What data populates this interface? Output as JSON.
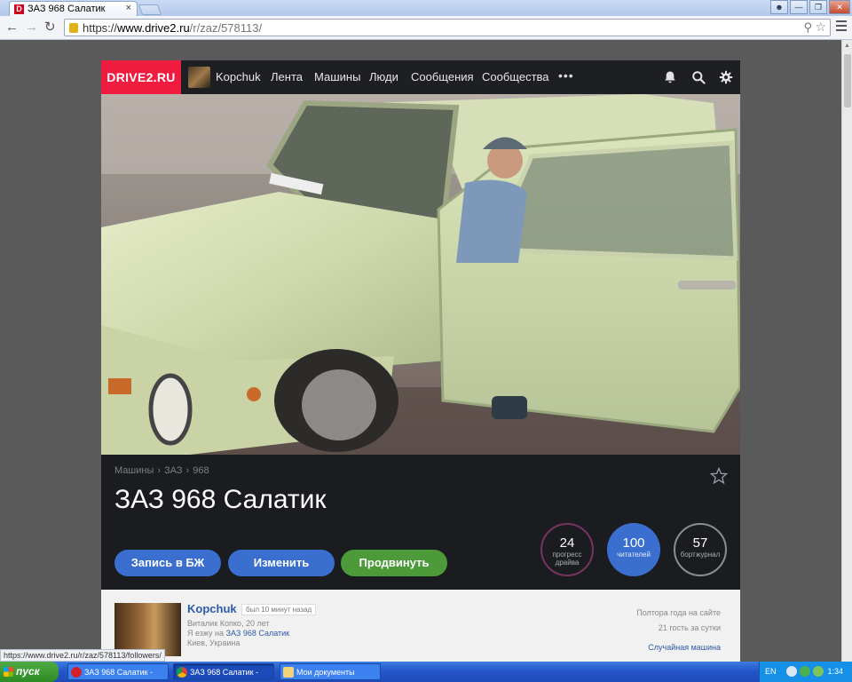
{
  "browser": {
    "tab_title": "ЗАЗ 968 Салатик",
    "tab_favicon": "D",
    "tab_close": "×",
    "url_scheme": "https://",
    "url_host": "www.drive2.ru",
    "url_path": "/r/zaz/578113/",
    "status_url": "https://www.drive2.ru/r/zaz/578113/followers/"
  },
  "site": {
    "logo": "DRIVE2.RU",
    "nav": {
      "user": "Kopchuk",
      "feed": "Лента",
      "cars": "Машины",
      "people": "Люди",
      "messages": "Сообщения",
      "communities": "Сообщества",
      "more": "•••"
    }
  },
  "car": {
    "breadcrumbs": [
      "Машины",
      "ЗАЗ",
      "968"
    ],
    "title": "ЗАЗ 968 Салатик",
    "buttons": {
      "journal": "Запись в БЖ",
      "edit": "Изменить",
      "promote": "Продвинуть"
    },
    "stats": {
      "progress_num": "24",
      "progress_label1": "прогресс",
      "progress_label2": "драйва",
      "readers_num": "100",
      "readers_label": "читателей",
      "log_num": "57",
      "log_label": "бортжурнал"
    }
  },
  "owner": {
    "name": "Kopchuk",
    "last_seen": "был 10 минут назад",
    "info": "Виталик Копко, 20 лет",
    "drives_prefix": "Я езжу на",
    "drives_car": "ЗАЗ 968 Салатик",
    "city": "Киев, Украина",
    "on_site": "Полтора года на сайте",
    "guests": "21 гость за сутки",
    "random_car": "Случайная машина"
  },
  "taskbar": {
    "start": "пуск",
    "task1": "ЗАЗ 968 Салатик - O...",
    "task2": "ЗАЗ 968 Салатик - G...",
    "task3": "Мои документы",
    "lang": "EN",
    "time": "1:34"
  },
  "colors": {
    "brand_red": "#ef1c40",
    "button_blue": "#3a6fd0",
    "button_green": "#4d9a3a",
    "link_blue": "#2f5aa8"
  }
}
